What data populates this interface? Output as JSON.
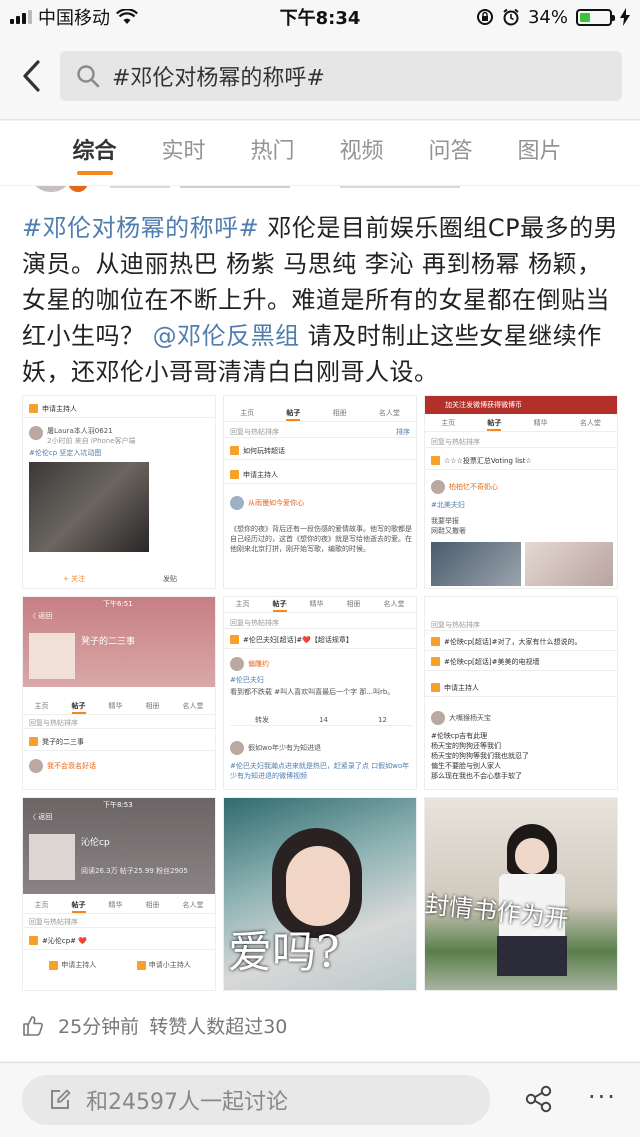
{
  "status_bar": {
    "carrier": "中国移动",
    "time": "下午8:34",
    "battery_percent": "34%",
    "battery_level": 0.34
  },
  "search": {
    "query": "#邓伦对杨幂的称呼#",
    "back_icon": "chevron-left-icon",
    "search_icon": "magnifier-icon"
  },
  "tabs": [
    {
      "label": "综合",
      "active": true
    },
    {
      "label": "实时"
    },
    {
      "label": "热门"
    },
    {
      "label": "视频"
    },
    {
      "label": "问答"
    },
    {
      "label": "图片"
    }
  ],
  "post": {
    "hashtag": "#邓伦对杨幂的称呼#",
    "text_1": " 邓伦是目前娱乐圈组CP最多的男演员。从迪丽热巴 杨紫 马思纯 李沁 再到杨幂 杨颖，女星的咖位在不断上升。难道是所有的女星都在倒贴当红小生吗？ ",
    "mention": "@邓伦反黑组",
    "text_2": " 请及时制止这些女星继续作妖，还邓伦小哥哥清清白白刚哥人设。",
    "time": "25分钟前",
    "repost_info": "转赞人数超过30"
  },
  "images": {
    "p1": {
      "apply_host": "申请主持人",
      "user": "屠Laura本人羽0621",
      "user_meta": "2小时前 来自 iPhone客户端",
      "caption": "#伦伦cp 坚定入坑动图",
      "follow": "+ 关注",
      "share": "发贴"
    },
    "p2": {
      "tabs": [
        "主页",
        "帖子",
        "相册",
        "名人堂"
      ],
      "section": "回复与热帖排序",
      "sort": "排序",
      "row1": "如何玩转超话",
      "row2": "申请主持人",
      "user": "从雨慢如今爱你心",
      "body": "《想你的夜》背后还有一段伤感的爱情故事。他写的歌都是自己经历过的，这首《想你的夜》就是写给他逝去的爱。在他刚来北京打拼，刚开始写歌，编歌的时候。"
    },
    "p3": {
      "top": "加关注发微博获得微博币",
      "tabs": [
        "主页",
        "帖子",
        "精华",
        "名人堂"
      ],
      "section": "回复与热帖排序",
      "row1": "☆☆☆投票汇总Voting list☆",
      "user": "柏柏忆不奇奶心",
      "user_tag": "#北美夫妇",
      "body": "我要举报\n网鞋又撒奢"
    },
    "p4": {
      "back": "〈 返回",
      "status": "下午6:51",
      "title": "凳子的二三事",
      "tabs": [
        "主页",
        "帖子",
        "精华",
        "相册",
        "名人堂"
      ],
      "section": "回复与热帖排序",
      "row1": "凳子的二三事",
      "user": "我不会衰名好话"
    },
    "p5": {
      "tabs": [
        "主页",
        "帖子",
        "精华",
        "相册",
        "名人堂"
      ],
      "section": "回复与热帖排序",
      "row1": "#伦巴夫妇[超话]#❤️【超话规章】",
      "user": "偏雕约",
      "tag": "#伦巴夫妇",
      "body": "看到都不跌载 #叫人喜欢叫喜最后一个字 那...叫rb。",
      "user2": "假如wo年少有为知进退",
      "tag2": "#伦巴夫妇我瀚点进来就是热巴，赶紧录了点 口假如wo年少有为知进退的微博视频",
      "repost": "转发",
      "comments": "14",
      "likes": "12"
    },
    "p6": {
      "section": "回复与热帖排序",
      "row1": "#伦映cp[超话]#对了，大家有什么想说的。",
      "row2": "#伦映cp[超话]#美美的电视墙",
      "row3": "申请主持人",
      "user": "大嘴猴杨天宝",
      "body": "#伦映cp吉有此理\n杨天宝的狗狗还等我们\n杨天宝的狗狗等我们我也就忍了\n偏生不要脸与别人家人\n那么现在我也不会心慈手软了"
    },
    "p7": {
      "back": "〈 返回",
      "status": "下午8:53",
      "title": "沁伦cp",
      "stats": "阅读26.3万  帖子25.99  粉丝2905",
      "tabs": [
        "主页",
        "帖子",
        "精华",
        "相册",
        "名人堂"
      ],
      "section": "回复与热帖排序",
      "row1": "#沁伦cp# ❤️",
      "host1": "申请主持人",
      "host2": "申请小主持人"
    },
    "p8": {
      "caption": "爱吗?"
    },
    "p9": {
      "caption": "封情书作为开"
    }
  },
  "bottom": {
    "comment_placeholder": "和24597人一起讨论",
    "edit_icon": "edit-icon",
    "share_icon": "share-icon",
    "more_icon": "more-icon",
    "more_label": "···"
  },
  "colors": {
    "accent_orange": "#f7871d",
    "link_blue": "#507daf",
    "battery_green": "#3cc23c"
  }
}
